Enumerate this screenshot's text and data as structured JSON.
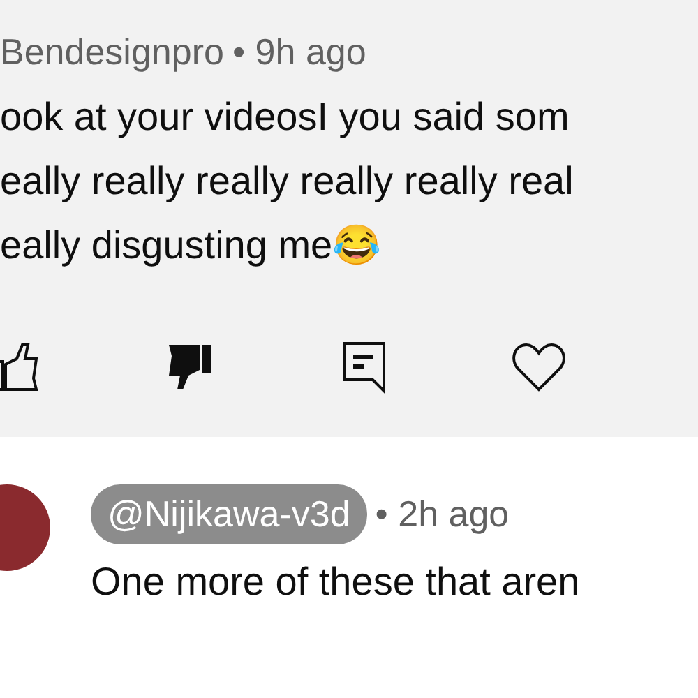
{
  "comments": [
    {
      "highlighted": true,
      "owner_badge": false,
      "author": "Bendesignpro",
      "time": "• 9h ago",
      "lines": [
        "ook at your videosI you said som",
        "eally really really really really real",
        "eally disgusting me😂"
      ],
      "liked": false,
      "disliked": true,
      "hearted": false
    },
    {
      "highlighted": false,
      "owner_badge": true,
      "author": "@Nijikawa-v3d",
      "time": "• 2h ago",
      "lines": [
        "One more of these that aren"
      ]
    }
  ]
}
